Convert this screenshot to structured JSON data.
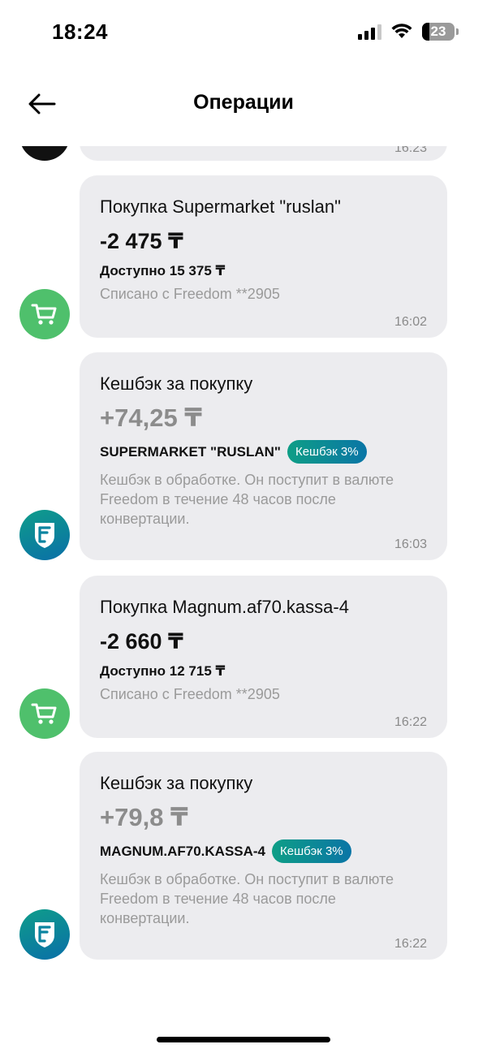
{
  "status": {
    "time": "18:24",
    "battery": "23",
    "battery_level": 0.23
  },
  "header": {
    "title": "Операции"
  },
  "partial_time": "16:23",
  "operations": [
    {
      "type": "purchase",
      "title": "Покупка Supermarket \"ruslan\"",
      "amount": "-2 475 ₸",
      "available": "Доступно 15 375 ₸",
      "source": "Списано с Freedom **2905",
      "time": "16:02",
      "icon": "cart-icon"
    },
    {
      "type": "cashback",
      "title": "Кешбэк за покупку",
      "amount": "+74,25 ₸",
      "merchant": "SUPERMARKET \"RUSLAN\"",
      "badge": "Кешбэк 3%",
      "note": "Кешбэк в обработке. Он поступит в валюте Freedom в течение 48 часов после конвертации.",
      "time": "16:03",
      "icon": "freedom-logo-icon"
    },
    {
      "type": "purchase",
      "title": "Покупка Magnum.af70.kassa-4",
      "amount": "-2 660 ₸",
      "available": "Доступно 12 715 ₸",
      "source": "Списано с Freedom **2905",
      "time": "16:22",
      "icon": "cart-icon"
    },
    {
      "type": "cashback",
      "title": "Кешбэк за покупку",
      "amount": "+79,8 ₸",
      "merchant": "MAGNUM.AF70.KASSA-4",
      "badge": "Кешбэк 3%",
      "note": "Кешбэк в обработке. Он поступит в валюте Freedom в течение 48 часов после конвертации.",
      "time": "16:22",
      "icon": "freedom-logo-icon"
    }
  ],
  "colors": {
    "cart_green": "#4fc06c",
    "brand_teal": "#0e9e86",
    "brand_blue": "#0a75a6",
    "bubble_bg": "#ececef"
  }
}
